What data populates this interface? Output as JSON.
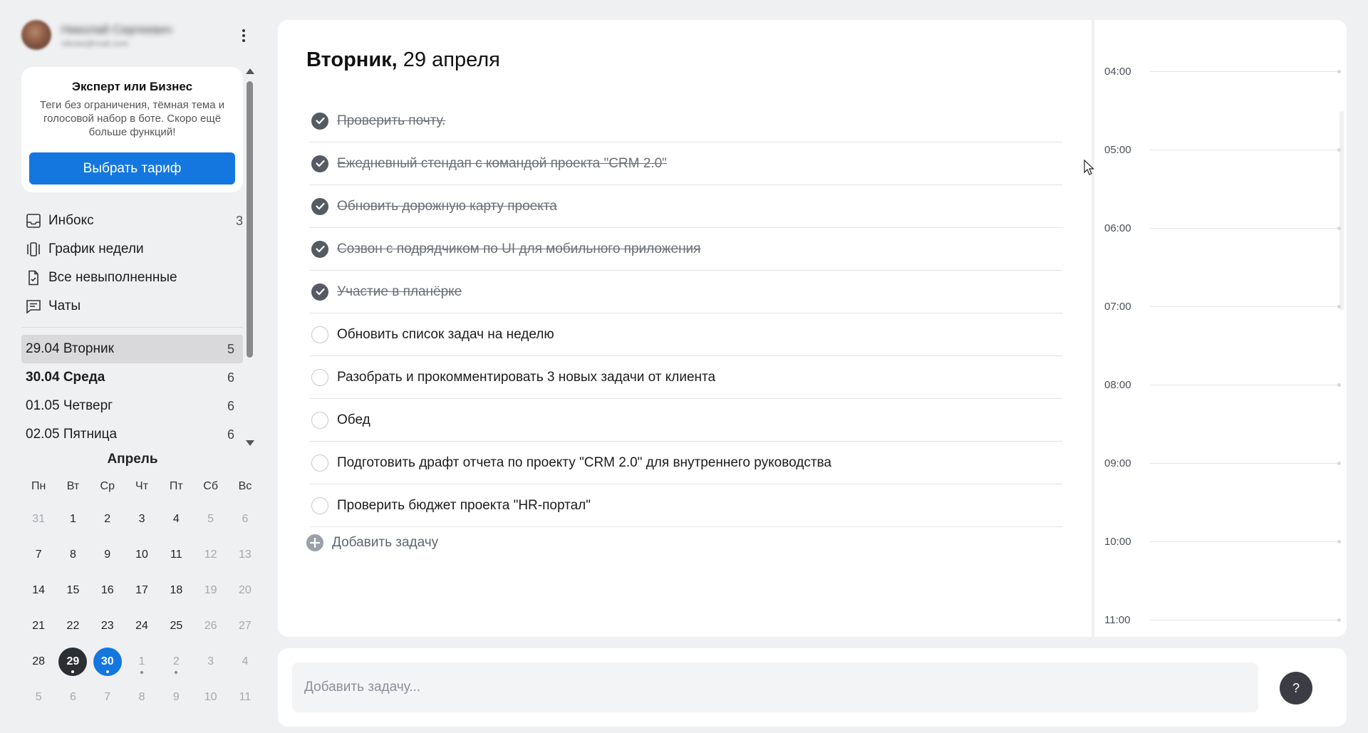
{
  "user": {
    "name": "Николай Сергеевич",
    "subtitle": "nikolai@mail.com"
  },
  "promo": {
    "title": "Эксперт или Бизнес",
    "text": "Теги без ограничения, тёмная тема и голосовой набор в боте. Скоро ещё больше функций!",
    "button": "Выбрать тариф"
  },
  "nav": [
    {
      "label": "Инбокс",
      "count": "3",
      "icon": "inbox-icon"
    },
    {
      "label": "График недели",
      "count": "",
      "icon": "week-schedule-icon"
    },
    {
      "label": "Все невыполненные",
      "count": "",
      "icon": "document-check-icon"
    },
    {
      "label": "Чаты",
      "count": "",
      "icon": "chat-icon"
    }
  ],
  "days": [
    {
      "label": "29.04 Вторник",
      "count": "5",
      "active": true,
      "bold": false
    },
    {
      "label": "30.04 Среда",
      "count": "6",
      "active": false,
      "bold": true
    },
    {
      "label": "01.05 Четверг",
      "count": "6",
      "active": false,
      "bold": false
    },
    {
      "label": "02.05 Пятница",
      "count": "6",
      "active": false,
      "bold": false
    }
  ],
  "calendar": {
    "month": "Апрель",
    "weekdays": [
      "Пн",
      "Вт",
      "Ср",
      "Чт",
      "Пт",
      "Сб",
      "Вс"
    ],
    "weeks": [
      [
        {
          "d": "31",
          "m": true
        },
        {
          "d": "1"
        },
        {
          "d": "2"
        },
        {
          "d": "3"
        },
        {
          "d": "4"
        },
        {
          "d": "5",
          "m": true
        },
        {
          "d": "6",
          "m": true
        }
      ],
      [
        {
          "d": "7"
        },
        {
          "d": "8"
        },
        {
          "d": "9"
        },
        {
          "d": "10"
        },
        {
          "d": "11"
        },
        {
          "d": "12",
          "m": true
        },
        {
          "d": "13",
          "m": true
        }
      ],
      [
        {
          "d": "14"
        },
        {
          "d": "15"
        },
        {
          "d": "16"
        },
        {
          "d": "17"
        },
        {
          "d": "18"
        },
        {
          "d": "19",
          "m": true
        },
        {
          "d": "20",
          "m": true
        }
      ],
      [
        {
          "d": "21"
        },
        {
          "d": "22"
        },
        {
          "d": "23"
        },
        {
          "d": "24"
        },
        {
          "d": "25"
        },
        {
          "d": "26",
          "m": true
        },
        {
          "d": "27",
          "m": true
        }
      ],
      [
        {
          "d": "28"
        },
        {
          "d": "29",
          "today": true,
          "dot": true
        },
        {
          "d": "30",
          "sel": true,
          "dot": true
        },
        {
          "d": "1",
          "m": true,
          "dot": true
        },
        {
          "d": "2",
          "m": true,
          "dot": true
        },
        {
          "d": "3",
          "m": true
        },
        {
          "d": "4",
          "m": true
        }
      ],
      [
        {
          "d": "5",
          "m": true
        },
        {
          "d": "6",
          "m": true
        },
        {
          "d": "7",
          "m": true
        },
        {
          "d": "8",
          "m": true
        },
        {
          "d": "9",
          "m": true
        },
        {
          "d": "10",
          "m": true
        },
        {
          "d": "11",
          "m": true
        }
      ]
    ]
  },
  "main": {
    "title_weekday": "Вторник,",
    "title_date": " 29 апреля",
    "tasks": [
      {
        "text": "Проверить почту.",
        "done": true
      },
      {
        "text": "Ежедневный стендап с командой проекта \"CRM 2.0\"",
        "done": true
      },
      {
        "text": "Обновить дорожную карту проекта",
        "done": true
      },
      {
        "text": "Созвон с подрядчиком по UI для мобильного приложения",
        "done": true
      },
      {
        "text": "Участие в планёрке",
        "done": true
      },
      {
        "text": "Обновить список задач на неделю",
        "done": false
      },
      {
        "text": "Разобрать и прокомментировать 3 новых задачи от клиента",
        "done": false
      },
      {
        "text": "Обед",
        "done": false
      },
      {
        "text": "Подготовить драфт отчета по проекту \"CRM 2.0\" для внутреннего руководства",
        "done": false
      },
      {
        "text": "Проверить бюджет проекта \"HR-портал\"",
        "done": false
      }
    ],
    "add_task_label": "Добавить задачу"
  },
  "timeline": {
    "hours": [
      "04:00",
      "05:00",
      "06:00",
      "07:00",
      "08:00",
      "09:00",
      "10:00",
      "11:00"
    ]
  },
  "bottom": {
    "placeholder": "Добавить задачу...",
    "help_label": "?"
  }
}
